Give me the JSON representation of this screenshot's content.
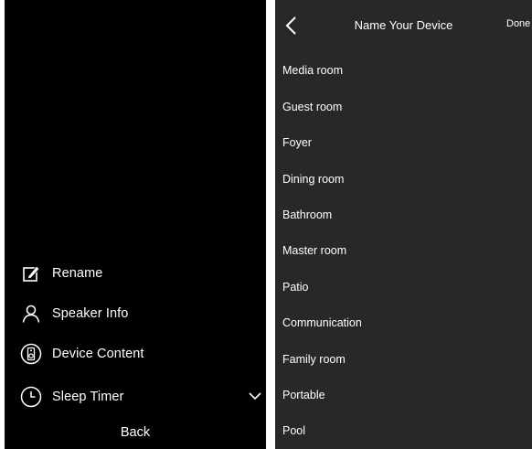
{
  "left_menu": {
    "items": [
      {
        "label": "Rename",
        "icon": "edit-icon"
      },
      {
        "label": "Speaker Info",
        "icon": "person-icon"
      },
      {
        "label": "Device Content",
        "icon": "speaker-icon"
      },
      {
        "label": "Sleep Timer",
        "icon": "clock-icon"
      }
    ],
    "back_label": "Back"
  },
  "right_panel": {
    "title": "Name Your Device",
    "done_label": "Done",
    "rooms": [
      "Media room",
      "Guest room",
      "Foyer",
      "Dining room",
      "Bathroom",
      "Master room",
      "Patio",
      "Communication",
      "Family room",
      "Portable",
      "Pool"
    ]
  },
  "colors": {
    "left_background": "#000000",
    "right_background": "#282828",
    "text": "#ffffff"
  }
}
